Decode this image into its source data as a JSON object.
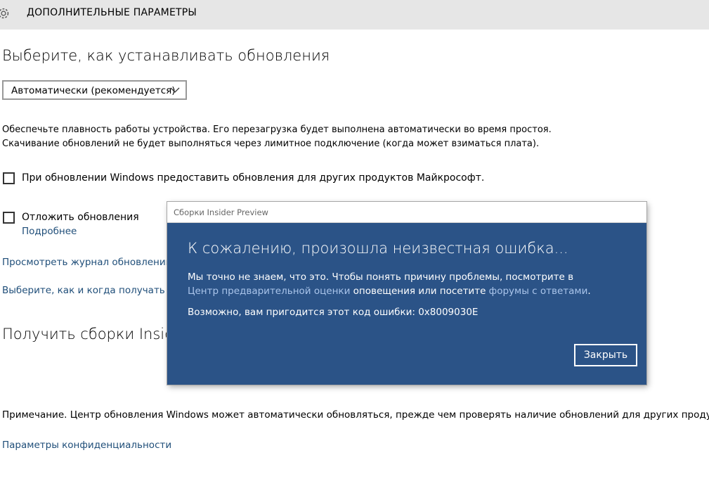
{
  "header": {
    "title": "ДОПОЛНИТЕЛЬНЫЕ ПАРАМЕТРЫ",
    "icon": "gear-icon"
  },
  "install": {
    "heading": "Выберите, как устанавливать обновления",
    "dropdown_value": "Автоматически (рекомендуется)",
    "desc_line1": "Обеспечьте плавность работы устройства. Его перезагрузка будет выполнена автоматически во время простоя.",
    "desc_line2": "Скачивание обновлений не будет выполняться через лимитное подключение (когда может взиматься плата)."
  },
  "options": {
    "other_products": {
      "label": "При обновлении Windows предоставить обновления для других продуктов Майкрософт.",
      "checked": false
    },
    "defer": {
      "label": "Отложить обновления",
      "checked": false,
      "more_link": "Подробнее"
    }
  },
  "links": {
    "history": "Просмотреть журнал обновлений",
    "delivery": "Выберите, как и когда получать обновления"
  },
  "insider": {
    "heading": "Получить сборки Insider Preview"
  },
  "note": "Примечание. Центр обновления Windows может автоматически обновляться, прежде чем проверять наличие обновлений для других продуктов",
  "privacy_link": "Параметры конфиденциальности",
  "dialog": {
    "window_title": "Сборки Insider Preview",
    "heading": "К сожалению, произошла неизвестная ошибка...",
    "line1": "Мы точно не знаем, что это. Чтобы понять причину проблемы, посмотрите в",
    "link1": "Центр предварительной оценки",
    "mid": " оповещения или посетите ",
    "link2": "форумы с ответами",
    "end": ".",
    "code_line": "Возможно, вам пригодится этот код ошибки: 0x8009030E",
    "close_label": "Закрыть"
  },
  "colors": {
    "dialog_bg": "#2b5387",
    "link": "#1f4e79",
    "header_bg": "#e6e6e6"
  }
}
